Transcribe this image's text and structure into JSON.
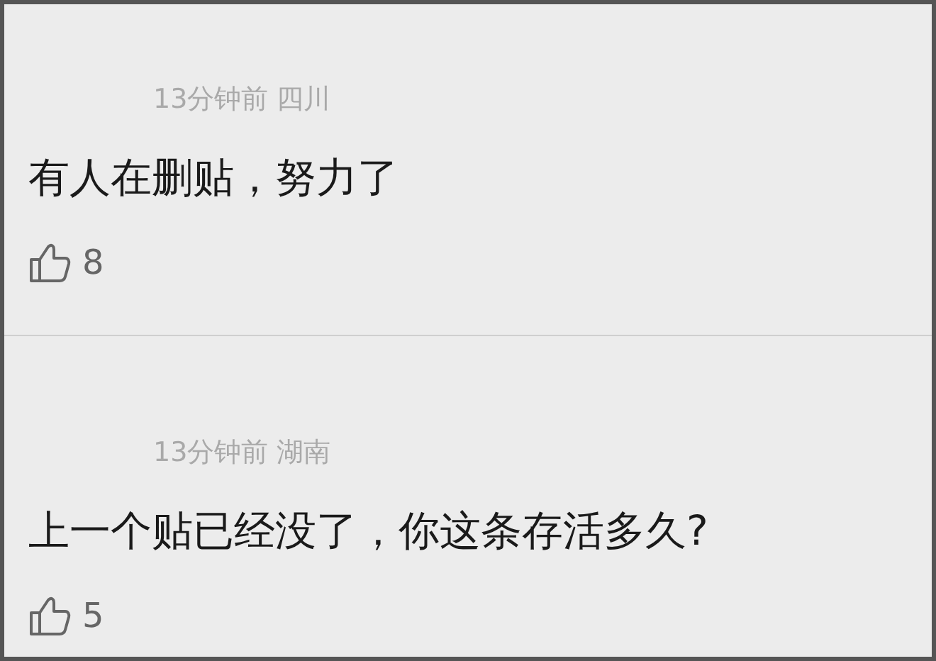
{
  "comments": [
    {
      "meta": "13分钟前 四川",
      "text": "有人在删贴，努力了",
      "likes": "8"
    },
    {
      "meta": "13分钟前 湖南",
      "text": "上一个贴已经没了，你这条存活多久?",
      "likes": "5"
    }
  ]
}
